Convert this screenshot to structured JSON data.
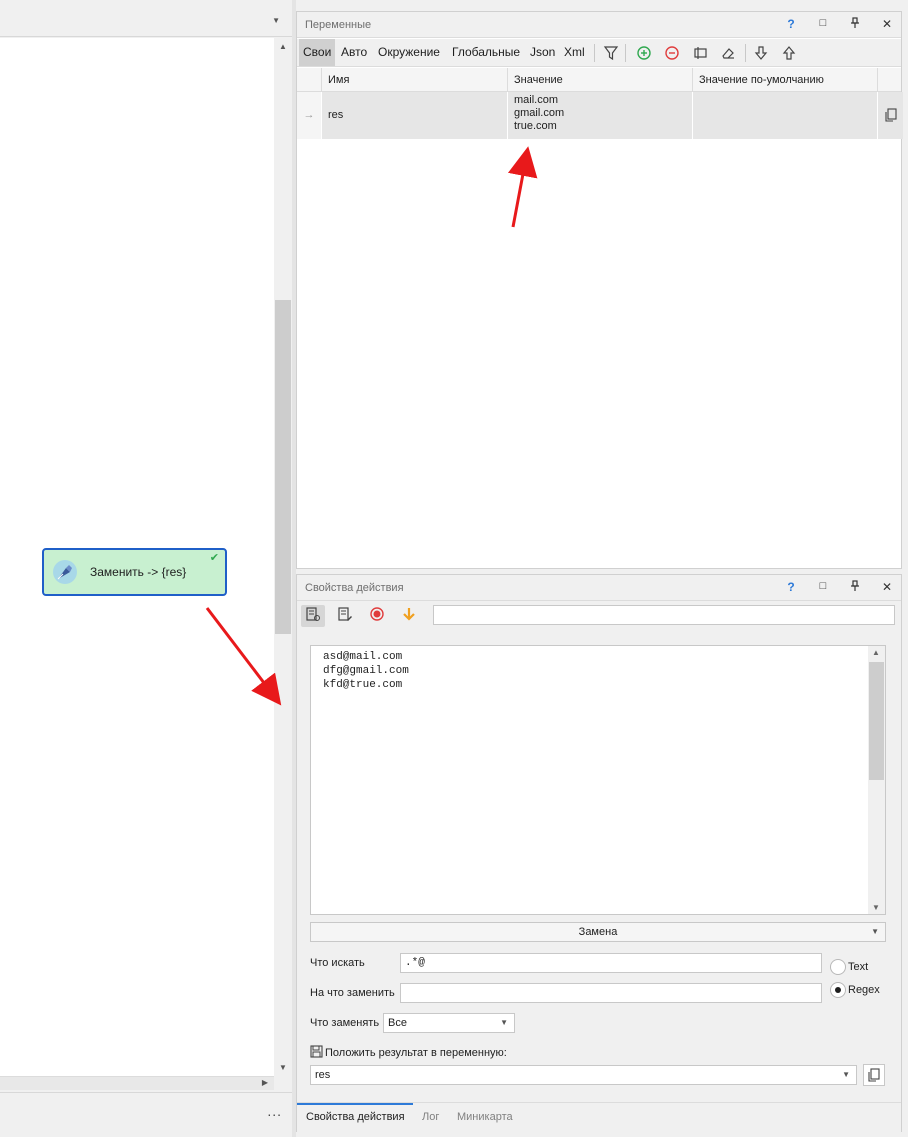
{
  "left_panel": {
    "dropdown_icon": "caret-down-icon",
    "more_label": "...",
    "node": {
      "label": "Заменить -> {res}",
      "icon": "pen-nib-icon",
      "status_icon": "check-icon",
      "bg_color": "#c8f0d0",
      "border_color": "#1f5fc8"
    }
  },
  "variables_panel": {
    "title": "Переменные",
    "header_buttons": {
      "help": "?",
      "maximize": "□",
      "pin": "⊥",
      "close": "✕"
    },
    "tabs": [
      "Свои",
      "Авто",
      "Окружение",
      "Глобальные",
      "Json",
      "Xml"
    ],
    "active_tab": "Свои",
    "toolbar_icons": [
      "filter-icon",
      "add-icon",
      "remove-icon",
      "column-icon",
      "eraser-icon",
      "arrow-down-icon",
      "arrow-up-icon"
    ],
    "columns": [
      "Имя",
      "Значение",
      "Значение по-умолчанию"
    ],
    "rows": [
      {
        "indicator": "→",
        "name": "res",
        "value_lines": [
          "mail.com",
          "gmail.com",
          "true.com"
        ],
        "default": ""
      }
    ]
  },
  "properties_panel": {
    "title": "Свойства действия",
    "header_buttons": {
      "help": "?",
      "maximize": "□",
      "pin": "⊥",
      "close": "✕"
    },
    "toolbar_icons": [
      "action-settings-icon",
      "edit-note-icon",
      "record-icon",
      "arrow-down-orange-icon"
    ],
    "search_value": "",
    "text_lines": "asd@mail.com\ndfg@gmail.com\nkfd@true.com",
    "mode": "Замена",
    "find_label": "Что искать",
    "find_value": ".*@",
    "replace_label": "На что заменить",
    "replace_value": "",
    "what_label": "Что заменять",
    "what_value": "Все",
    "radio_text": "Text",
    "radio_regex": "Regex",
    "selected_radio": "Regex",
    "result_label": "Положить результат в переменную:",
    "result_value": "res",
    "bottom_tabs": [
      "Свойства действия",
      "Лог",
      "Миникарта"
    ],
    "active_bottom_tab": "Свойства действия"
  },
  "colors": {
    "accent_blue": "#2d7ad8",
    "annotation_red": "#e8191b",
    "add_green": "#2fa84f",
    "remove_red": "#e03c3c",
    "record_red": "#e03c3c",
    "orange": "#f0a020"
  }
}
